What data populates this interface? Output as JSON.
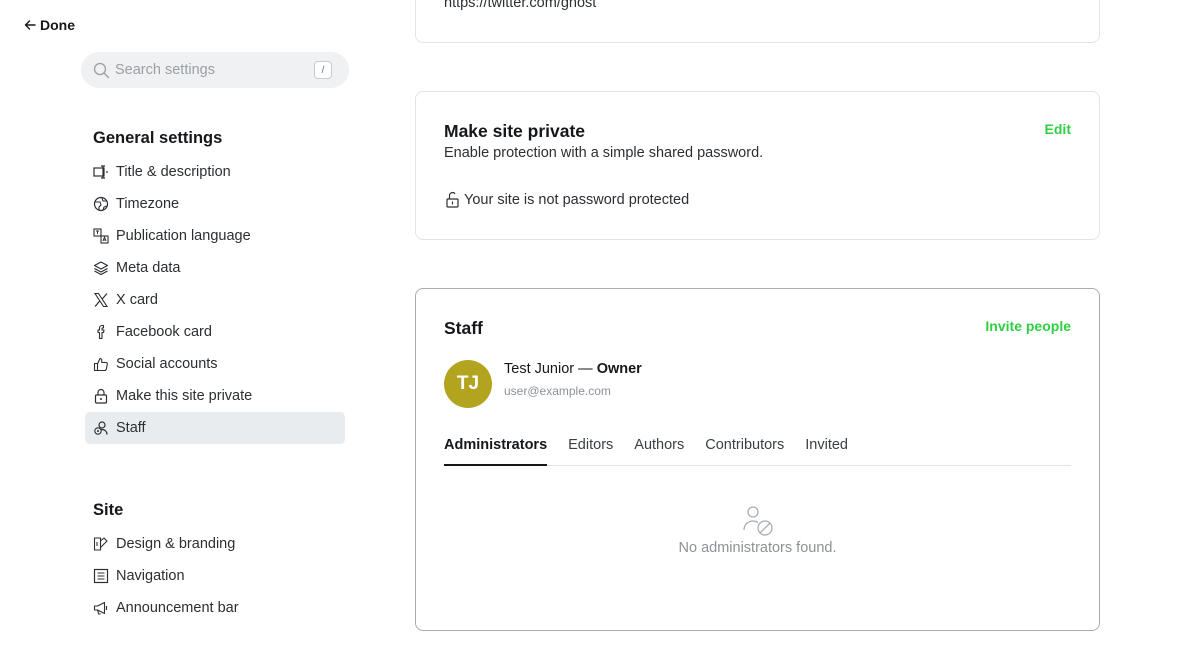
{
  "header": {
    "done_label": "Done"
  },
  "search": {
    "placeholder": "Search settings",
    "shortcut": "/"
  },
  "sidebar": {
    "general_heading": "General settings",
    "general_items": [
      {
        "label": "Title & description",
        "icon": "title-description-icon"
      },
      {
        "label": "Timezone",
        "icon": "globe-icon"
      },
      {
        "label": "Publication language",
        "icon": "translate-icon"
      },
      {
        "label": "Meta data",
        "icon": "layers-icon"
      },
      {
        "label": "X card",
        "icon": "x-logo-icon"
      },
      {
        "label": "Facebook card",
        "icon": "facebook-icon"
      },
      {
        "label": "Social accounts",
        "icon": "thumbs-up-icon"
      },
      {
        "label": "Make this site private",
        "icon": "lock-icon"
      },
      {
        "label": "Staff",
        "icon": "staff-icon",
        "active": true
      }
    ],
    "site_heading": "Site",
    "site_items": [
      {
        "label": "Design & branding",
        "icon": "paintbrush-icon"
      },
      {
        "label": "Navigation",
        "icon": "navigation-icon"
      },
      {
        "label": "Announcement bar",
        "icon": "megaphone-icon"
      }
    ]
  },
  "social_card": {
    "link": "https://twitter.com/ghost"
  },
  "private_card": {
    "title": "Make site private",
    "description": "Enable protection with a simple shared password.",
    "edit_label": "Edit",
    "status": "Your site is not password protected"
  },
  "staff_card": {
    "title": "Staff",
    "invite_label": "Invite people",
    "owner": {
      "initials": "TJ",
      "name": "Test Junior",
      "separator": " — ",
      "role": "Owner",
      "email": "user@example.com",
      "avatar_color": "#b3a41f"
    },
    "tabs": [
      "Administrators",
      "Editors",
      "Authors",
      "Contributors",
      "Invited"
    ],
    "active_tab": "Administrators",
    "empty_message": "No administrators found."
  },
  "colors": {
    "accent": "#30cf43",
    "active_nav_bg": "#e9ecee"
  }
}
